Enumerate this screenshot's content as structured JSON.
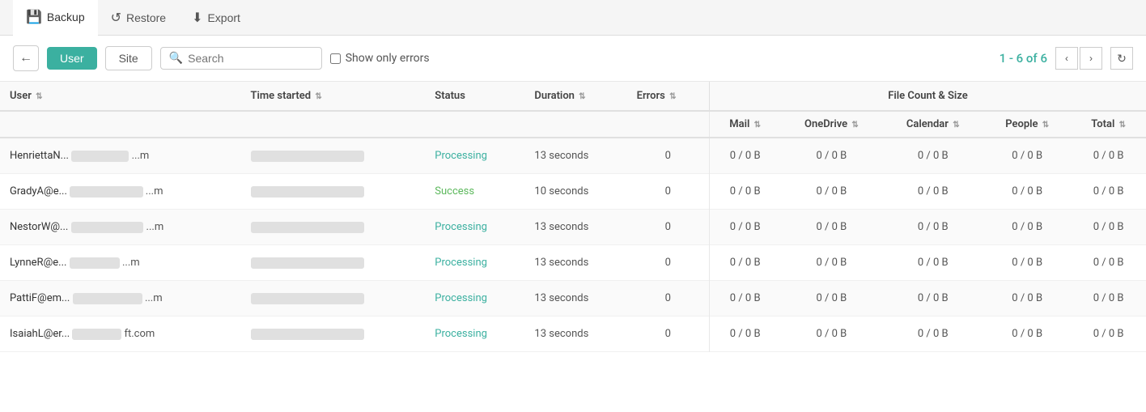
{
  "nav": {
    "backup_label": "Backup",
    "restore_label": "Restore",
    "export_label": "Export",
    "backup_icon": "💾",
    "restore_icon": "↺",
    "export_icon": "⬇"
  },
  "toolbar": {
    "back_label": "←",
    "user_label": "User",
    "site_label": "Site",
    "search_placeholder": "Search",
    "show_errors_label": "Show only errors",
    "pagination": "1 - 6 of 6",
    "prev_icon": "‹",
    "next_icon": "›",
    "refresh_icon": "↻"
  },
  "table": {
    "col_user": "User",
    "col_time_started": "Time started",
    "col_status": "Status",
    "col_duration": "Duration",
    "col_errors": "Errors",
    "col_file_count_size": "File Count & Size",
    "col_mail": "Mail",
    "col_onedrive": "OneDrive",
    "col_calendar": "Calendar",
    "col_people": "People",
    "col_total": "Total",
    "rows": [
      {
        "user": "HenriettaN...",
        "user_suffix": "...m",
        "time": "",
        "status": "Processing",
        "status_type": "processing",
        "duration": "13 seconds",
        "errors": "0",
        "mail": "0 / 0 B",
        "onedrive": "0 / 0 B",
        "calendar": "0 / 0 B",
        "people": "0 / 0 B",
        "total": "0 / 0 B"
      },
      {
        "user": "GradyA@e...",
        "user_suffix": "...m",
        "time": "",
        "status": "Success",
        "status_type": "success",
        "duration": "10 seconds",
        "errors": "0",
        "mail": "0 / 0 B",
        "onedrive": "0 / 0 B",
        "calendar": "0 / 0 B",
        "people": "0 / 0 B",
        "total": "0 / 0 B"
      },
      {
        "user": "NestorW@...",
        "user_suffix": "...m",
        "time": "",
        "status": "Processing",
        "status_type": "processing",
        "duration": "13 seconds",
        "errors": "0",
        "mail": "0 / 0 B",
        "onedrive": "0 / 0 B",
        "calendar": "0 / 0 B",
        "people": "0 / 0 B",
        "total": "0 / 0 B"
      },
      {
        "user": "LynneR@e...",
        "user_suffix": "...m",
        "time": "",
        "status": "Processing",
        "status_type": "processing",
        "duration": "13 seconds",
        "errors": "0",
        "mail": "0 / 0 B",
        "onedrive": "0 / 0 B",
        "calendar": "0 / 0 B",
        "people": "0 / 0 B",
        "total": "0 / 0 B"
      },
      {
        "user": "PattiF@em...",
        "user_suffix": "...m",
        "time": "",
        "status": "Processing",
        "status_type": "processing",
        "duration": "13 seconds",
        "errors": "0",
        "mail": "0 / 0 B",
        "onedrive": "0 / 0 B",
        "calendar": "0 / 0 B",
        "people": "0 / 0 B",
        "total": "0 / 0 B"
      },
      {
        "user": "IsaiahL@er...",
        "user_suffix": "ft.com",
        "time": "",
        "status": "Processing",
        "status_type": "processing",
        "duration": "13 seconds",
        "errors": "0",
        "mail": "0 / 0 B",
        "onedrive": "0 / 0 B",
        "calendar": "0 / 0 B",
        "people": "0 / 0 B",
        "total": "0 / 0 B"
      }
    ]
  }
}
